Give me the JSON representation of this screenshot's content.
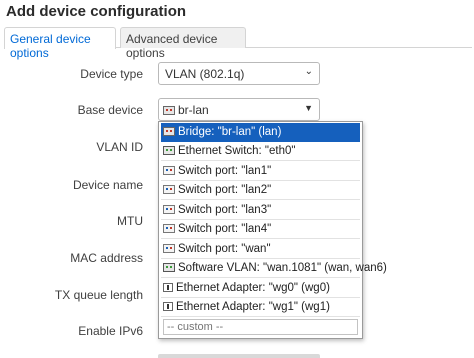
{
  "dialog": {
    "title": "Add device configuration"
  },
  "tabs": [
    {
      "label": "General device options",
      "active": true
    },
    {
      "label": "Advanced device options",
      "active": false
    }
  ],
  "form": {
    "device_type": {
      "label": "Device type",
      "value": "VLAN (802.1q)"
    },
    "base_device": {
      "label": "Base device",
      "value": "br-lan"
    },
    "vlan_id": {
      "label": "VLAN ID"
    },
    "device_name": {
      "label": "Device name"
    },
    "mtu": {
      "label": "MTU"
    },
    "mac_address": {
      "label": "MAC address"
    },
    "tx_queue_length": {
      "label": "TX queue length"
    },
    "enable_ipv6": {
      "label": "Enable IPv6"
    }
  },
  "dropdown": {
    "options": [
      {
        "label": "Bridge: \"br-lan\" (lan)",
        "icon": "bridge-icon",
        "selected": true
      },
      {
        "label": "Ethernet Switch: \"eth0\"",
        "icon": "ethernet-icon",
        "selected": false
      },
      {
        "label": "Switch port: \"lan1\"",
        "icon": "switch-port-icon",
        "selected": false
      },
      {
        "label": "Switch port: \"lan2\"",
        "icon": "switch-port-icon",
        "selected": false
      },
      {
        "label": "Switch port: \"lan3\"",
        "icon": "switch-port-icon",
        "selected": false
      },
      {
        "label": "Switch port: \"lan4\"",
        "icon": "switch-port-icon",
        "selected": false
      },
      {
        "label": "Switch port: \"wan\"",
        "icon": "switch-port-icon",
        "selected": false
      },
      {
        "label": "Software VLAN: \"wan.1081\" (wan, wan6)",
        "icon": "vlan-icon",
        "selected": false
      },
      {
        "label": "Ethernet Adapter: \"wg0\" (wg0)",
        "icon": "wireguard-icon",
        "selected": false
      },
      {
        "label": "Ethernet Adapter: \"wg1\" (wg1)",
        "icon": "wireguard-icon",
        "selected": false
      }
    ],
    "custom_placeholder": "-- custom --"
  }
}
